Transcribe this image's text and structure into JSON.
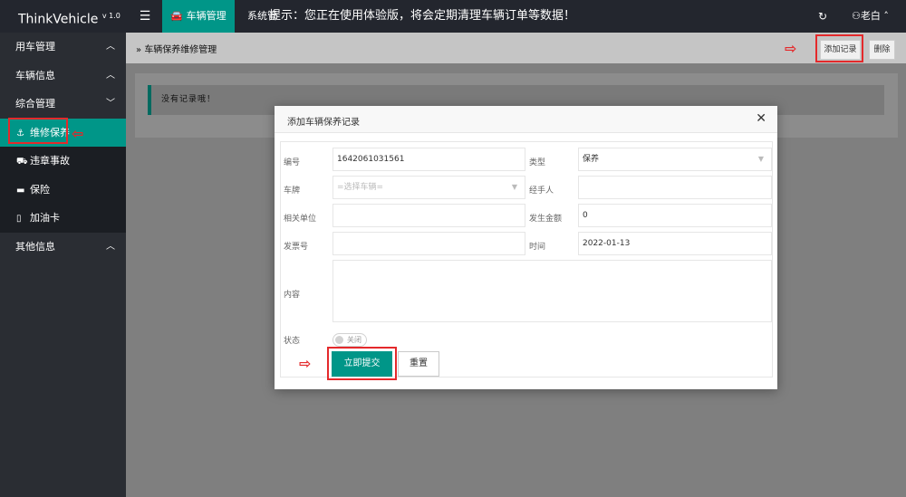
{
  "app": {
    "logo": "ThinkVehicle",
    "version": "v 1.0"
  },
  "header": {
    "menu_toggle_icon": "hamburger-icon",
    "active_nav": "车辆管理",
    "system_nav": "系统管",
    "notice": "提示：您正在使用体验版，将会定期清理车辆订单等数据！",
    "user_name": "老白",
    "accent_color": "#009688"
  },
  "sidebar": {
    "groups": [
      {
        "label": "用车管理",
        "expanded": false
      },
      {
        "label": "车辆信息",
        "expanded": false
      },
      {
        "label": "综合管理",
        "expanded": true
      },
      {
        "label": "其他信息",
        "expanded": false
      }
    ],
    "subitems": [
      {
        "label": "维修保养",
        "icon": "anchor-icon",
        "active": true
      },
      {
        "label": "违章事故",
        "icon": "truck-icon",
        "active": false
      },
      {
        "label": "保险",
        "icon": "card-icon",
        "active": false
      },
      {
        "label": "加油卡",
        "icon": "file-icon",
        "active": false
      }
    ]
  },
  "page": {
    "breadcrumb": "车辆保养维修管理",
    "add_button": "添加记录",
    "delete_button": "删除",
    "empty_text": "没有记录哦！"
  },
  "modal": {
    "title": "添加车辆保养记录",
    "fields": {
      "number": {
        "label": "编号",
        "value": "1642061031561"
      },
      "type": {
        "label": "类型",
        "value": "保养"
      },
      "plate": {
        "label": "车牌",
        "placeholder": "=选择车辆="
      },
      "handler": {
        "label": "经手人",
        "value": ""
      },
      "unit": {
        "label": "相关单位",
        "value": ""
      },
      "amount": {
        "label": "发生金额",
        "value": "0"
      },
      "invoice": {
        "label": "发票号",
        "value": ""
      },
      "time": {
        "label": "时间",
        "value": "2022-01-13"
      },
      "content": {
        "label": "内容",
        "value": ""
      },
      "status": {
        "label": "状态",
        "value": "关闭"
      }
    },
    "submit_button": "立即提交",
    "reset_button": "重置"
  }
}
